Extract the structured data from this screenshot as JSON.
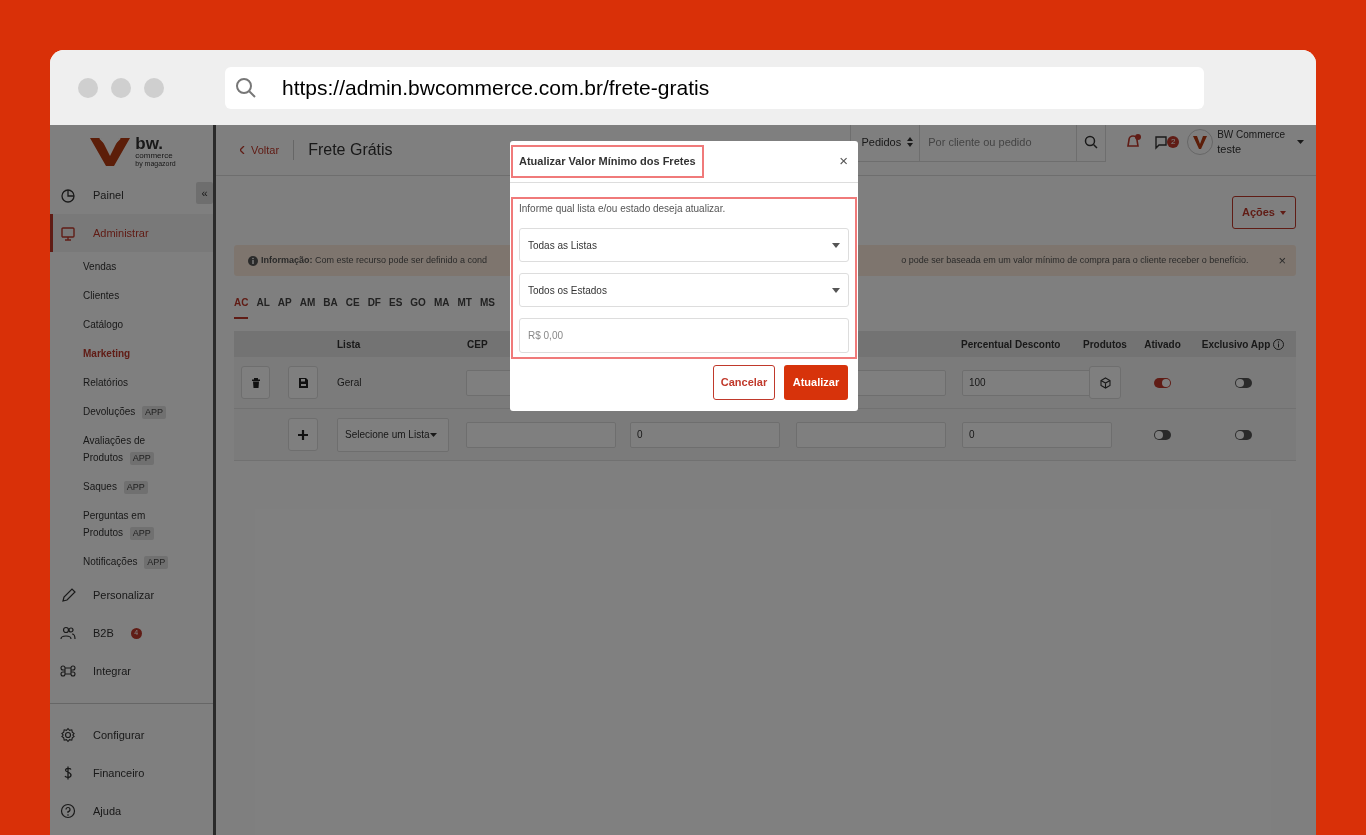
{
  "browser": {
    "url": "https://admin.bwcommerce.com.br/frete-gratis"
  },
  "logo": {
    "name": "bw.",
    "tagline": "commerce",
    "byline": "by magazord"
  },
  "sidebar": {
    "collapse_label": "«",
    "items": [
      {
        "label": "Painel",
        "selected": false
      },
      {
        "label": "Administrar",
        "selected": true,
        "expanded": true,
        "children": [
          {
            "label": "Vendas",
            "selected": false
          },
          {
            "label": "Clientes",
            "selected": false
          },
          {
            "label": "Catálogo",
            "selected": false
          },
          {
            "label": "Marketing",
            "selected": true
          },
          {
            "label": "Relatórios",
            "selected": false
          },
          {
            "label": "Devoluções",
            "badge": "APP",
            "selected": false
          },
          {
            "label": "Avaliações de Produtos",
            "badge": "APP",
            "selected": false
          },
          {
            "label": "Saques",
            "badge": "APP",
            "selected": false
          },
          {
            "label": "Perguntas em Produtos",
            "badge": "APP",
            "selected": false
          },
          {
            "label": "Notificações",
            "badge": "APP",
            "selected": false
          }
        ]
      },
      {
        "label": "Personalizar",
        "selected": false
      },
      {
        "label": "B2B",
        "count": "4",
        "selected": false
      },
      {
        "label": "Integrar",
        "selected": false
      }
    ],
    "bottom_items": [
      {
        "label": "Configurar",
        "selected": false
      },
      {
        "label": "Financeiro",
        "selected": false
      },
      {
        "label": "Ajuda",
        "selected": false
      }
    ]
  },
  "header": {
    "back_link": "Voltar",
    "title": "Frete Grátis",
    "search_scope": "Pedidos",
    "search_placeholder": "Por cliente ou pedido",
    "messages_count": "2",
    "user": {
      "name": "BW Commerce",
      "subtitle": "teste"
    }
  },
  "actions_button": "Ações",
  "info": {
    "label": "Informação:",
    "text_start": "Com este recurso pode ser definido a cond",
    "text_end": "o pode ser baseada em um valor mínimo de compra para o cliente receber o benefício.",
    "close": "×"
  },
  "state_tabs": [
    {
      "label": "AC",
      "selected": true
    },
    {
      "label": "AL",
      "selected": false
    },
    {
      "label": "AP",
      "selected": false
    },
    {
      "label": "AM",
      "selected": false
    },
    {
      "label": "BA",
      "selected": false
    },
    {
      "label": "CE",
      "selected": false
    },
    {
      "label": "DF",
      "selected": false
    },
    {
      "label": "ES",
      "selected": false
    },
    {
      "label": "GO",
      "selected": false
    },
    {
      "label": "MA",
      "selected": false
    },
    {
      "label": "MT",
      "selected": false
    },
    {
      "label": "MS",
      "selected": false
    }
  ],
  "table": {
    "columns": [
      "Lista",
      "CEP",
      "Percentual Desconto",
      "Produtos",
      "Ativado",
      "Exclusivo App"
    ],
    "rows": [
      {
        "kind": "existing",
        "list": "Geral",
        "discount_percent": "100",
        "enabled": true,
        "app_exclusive": false
      },
      {
        "kind": "new",
        "list": "Selecione um Lista",
        "column_5": "0",
        "discount_percent": "0",
        "enabled": false,
        "app_exclusive": false
      }
    ]
  },
  "modal": {
    "title": "Atualizar Valor Mínimo dos Fretes",
    "close": "×",
    "title_highlighted": true,
    "body_highlighted": true,
    "prompt": "Informe qual lista e/ou estado deseja atualizar.",
    "list_select": "Todas as Listas",
    "state_select": "Todos os Estados",
    "amount_placeholder": "R$ 0,00",
    "cancel": "Cancelar",
    "confirm": "Atualizar"
  }
}
